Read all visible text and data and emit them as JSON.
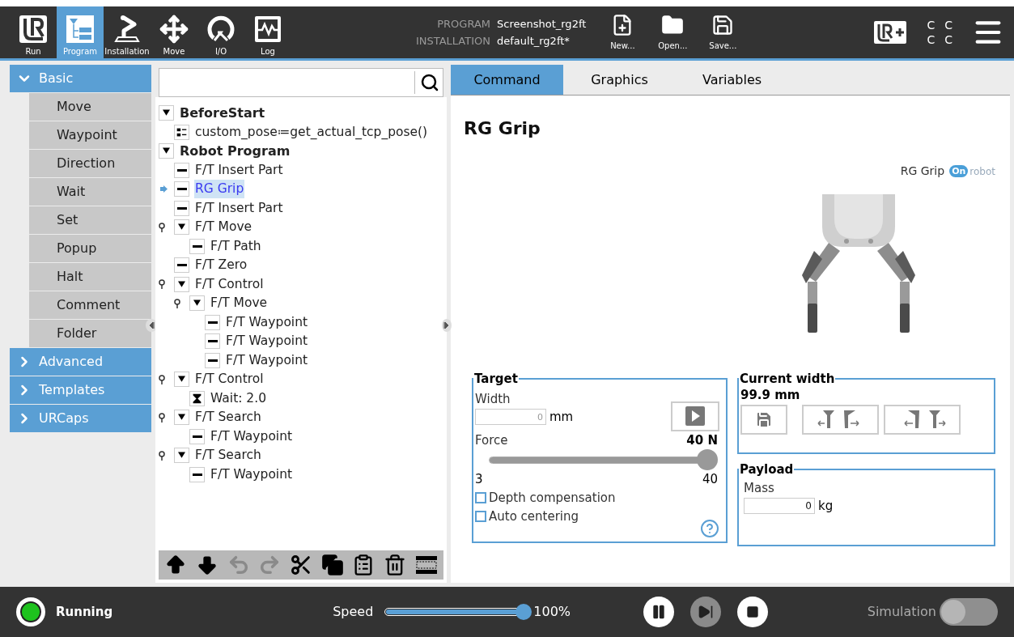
{
  "nav_tabs": [
    {
      "label": "Run",
      "kind": "run",
      "selected": false
    },
    {
      "label": "Program",
      "kind": "program",
      "selected": true
    },
    {
      "label": "Installation",
      "kind": "installation",
      "selected": false
    },
    {
      "label": "Move",
      "kind": "move",
      "selected": false
    },
    {
      "label": "I/O",
      "kind": "io",
      "selected": false
    },
    {
      "label": "Log",
      "kind": "log",
      "selected": false
    }
  ],
  "program_info": [
    {
      "label": "PROGRAM",
      "value": "Screenshot_rg2ft"
    },
    {
      "label": "INSTALLATION",
      "value": "default_rg2ft*"
    }
  ],
  "file_buttons": [
    {
      "label": "New...",
      "kind": "new"
    },
    {
      "label": "Open...",
      "kind": "open"
    },
    {
      "label": "Save...",
      "kind": "save"
    }
  ],
  "status_glyphs": [
    "C",
    "C",
    "C",
    "C"
  ],
  "sidebar": [
    {
      "label": "Basic",
      "expanded": true,
      "items": [
        "Move",
        "Waypoint",
        "Direction",
        "Wait",
        "Set",
        "Popup",
        "Halt",
        "Comment",
        "Folder"
      ]
    },
    {
      "label": "Advanced",
      "expanded": false
    },
    {
      "label": "Templates",
      "expanded": false
    },
    {
      "label": "URCaps",
      "expanded": false
    }
  ],
  "tree": [
    {
      "label": "BeforeStart",
      "kind": "group",
      "expanded": true,
      "selected": false,
      "children": [
        {
          "label": "custom_pose≔get_actual_tcp_pose()",
          "kind": "assignment",
          "selected": false
        }
      ]
    },
    {
      "label": "Robot Program",
      "kind": "group",
      "expanded": true,
      "selected": false,
      "children": [
        {
          "label": "F/T Insert Part",
          "kind": "command",
          "selected": false
        },
        {
          "label": "RG Grip",
          "kind": "command",
          "selected": true
        },
        {
          "label": "F/T Insert Part",
          "kind": "command",
          "selected": false
        },
        {
          "label": "F/T Move",
          "kind": "group",
          "expanded": true,
          "selected": false,
          "children": [
            {
              "label": "F/T Path",
              "kind": "command",
              "selected": false
            }
          ]
        },
        {
          "label": "F/T Zero",
          "kind": "command",
          "selected": false
        },
        {
          "label": "F/T Control",
          "kind": "group",
          "expanded": true,
          "selected": false,
          "children": [
            {
              "label": "F/T Move",
              "kind": "group",
              "expanded": true,
              "selected": false,
              "children": [
                {
                  "label": "F/T Waypoint",
                  "kind": "command",
                  "selected": false
                },
                {
                  "label": "F/T Waypoint",
                  "kind": "command",
                  "selected": false
                },
                {
                  "label": "F/T Waypoint",
                  "kind": "command",
                  "selected": false
                }
              ]
            }
          ]
        },
        {
          "label": "F/T Control",
          "kind": "group",
          "expanded": true,
          "selected": false,
          "children": [
            {
              "label": "Wait: 2.0",
              "kind": "wait",
              "selected": false
            }
          ]
        },
        {
          "label": "F/T Search",
          "kind": "group",
          "expanded": true,
          "selected": false,
          "children": [
            {
              "label": "F/T Waypoint",
              "kind": "command",
              "selected": false
            }
          ]
        },
        {
          "label": "F/T Search",
          "kind": "group",
          "expanded": true,
          "selected": false,
          "children": [
            {
              "label": "F/T Waypoint",
              "kind": "command",
              "selected": false
            }
          ]
        }
      ]
    }
  ],
  "tree_tools": [
    {
      "kind": "up",
      "disabled": false
    },
    {
      "kind": "down",
      "disabled": false
    },
    {
      "kind": "undo",
      "disabled": true
    },
    {
      "kind": "redo",
      "disabled": true
    },
    {
      "kind": "cut",
      "disabled": false
    },
    {
      "kind": "copy",
      "disabled": false
    },
    {
      "kind": "paste",
      "disabled": false
    },
    {
      "kind": "delete",
      "disabled": false
    },
    {
      "kind": "suppress",
      "disabled": false
    }
  ],
  "tabs": [
    {
      "label": "Command",
      "selected": true
    },
    {
      "label": "Graphics",
      "selected": false
    },
    {
      "label": "Variables",
      "selected": false
    }
  ],
  "command": {
    "title": "RG Grip",
    "product": "RG Grip",
    "brand_badge": "On",
    "brand_text": "robot",
    "target": {
      "title": "Target",
      "width_label": "Width",
      "width_value": "0",
      "width_unit": "mm",
      "force": {
        "label": "Force",
        "reading": "40 N",
        "level": 1.0,
        "min": "3",
        "max": "40"
      },
      "checkboxes": [
        {
          "label": "Depth compensation",
          "checked": false
        },
        {
          "label": "Auto centering",
          "checked": false
        }
      ]
    },
    "current_width": {
      "title": "Current width",
      "value": "99.9 mm"
    },
    "payload": {
      "title": "Payload",
      "mass_label": "Mass",
      "mass_value": "0",
      "mass_unit": "kg"
    }
  },
  "footer": {
    "status": "Running",
    "speed": {
      "label": "Speed",
      "level": 1.0,
      "reading": "100%"
    },
    "step_disabled": true,
    "simulation_label": "Simulation",
    "simulation_on": false
  }
}
